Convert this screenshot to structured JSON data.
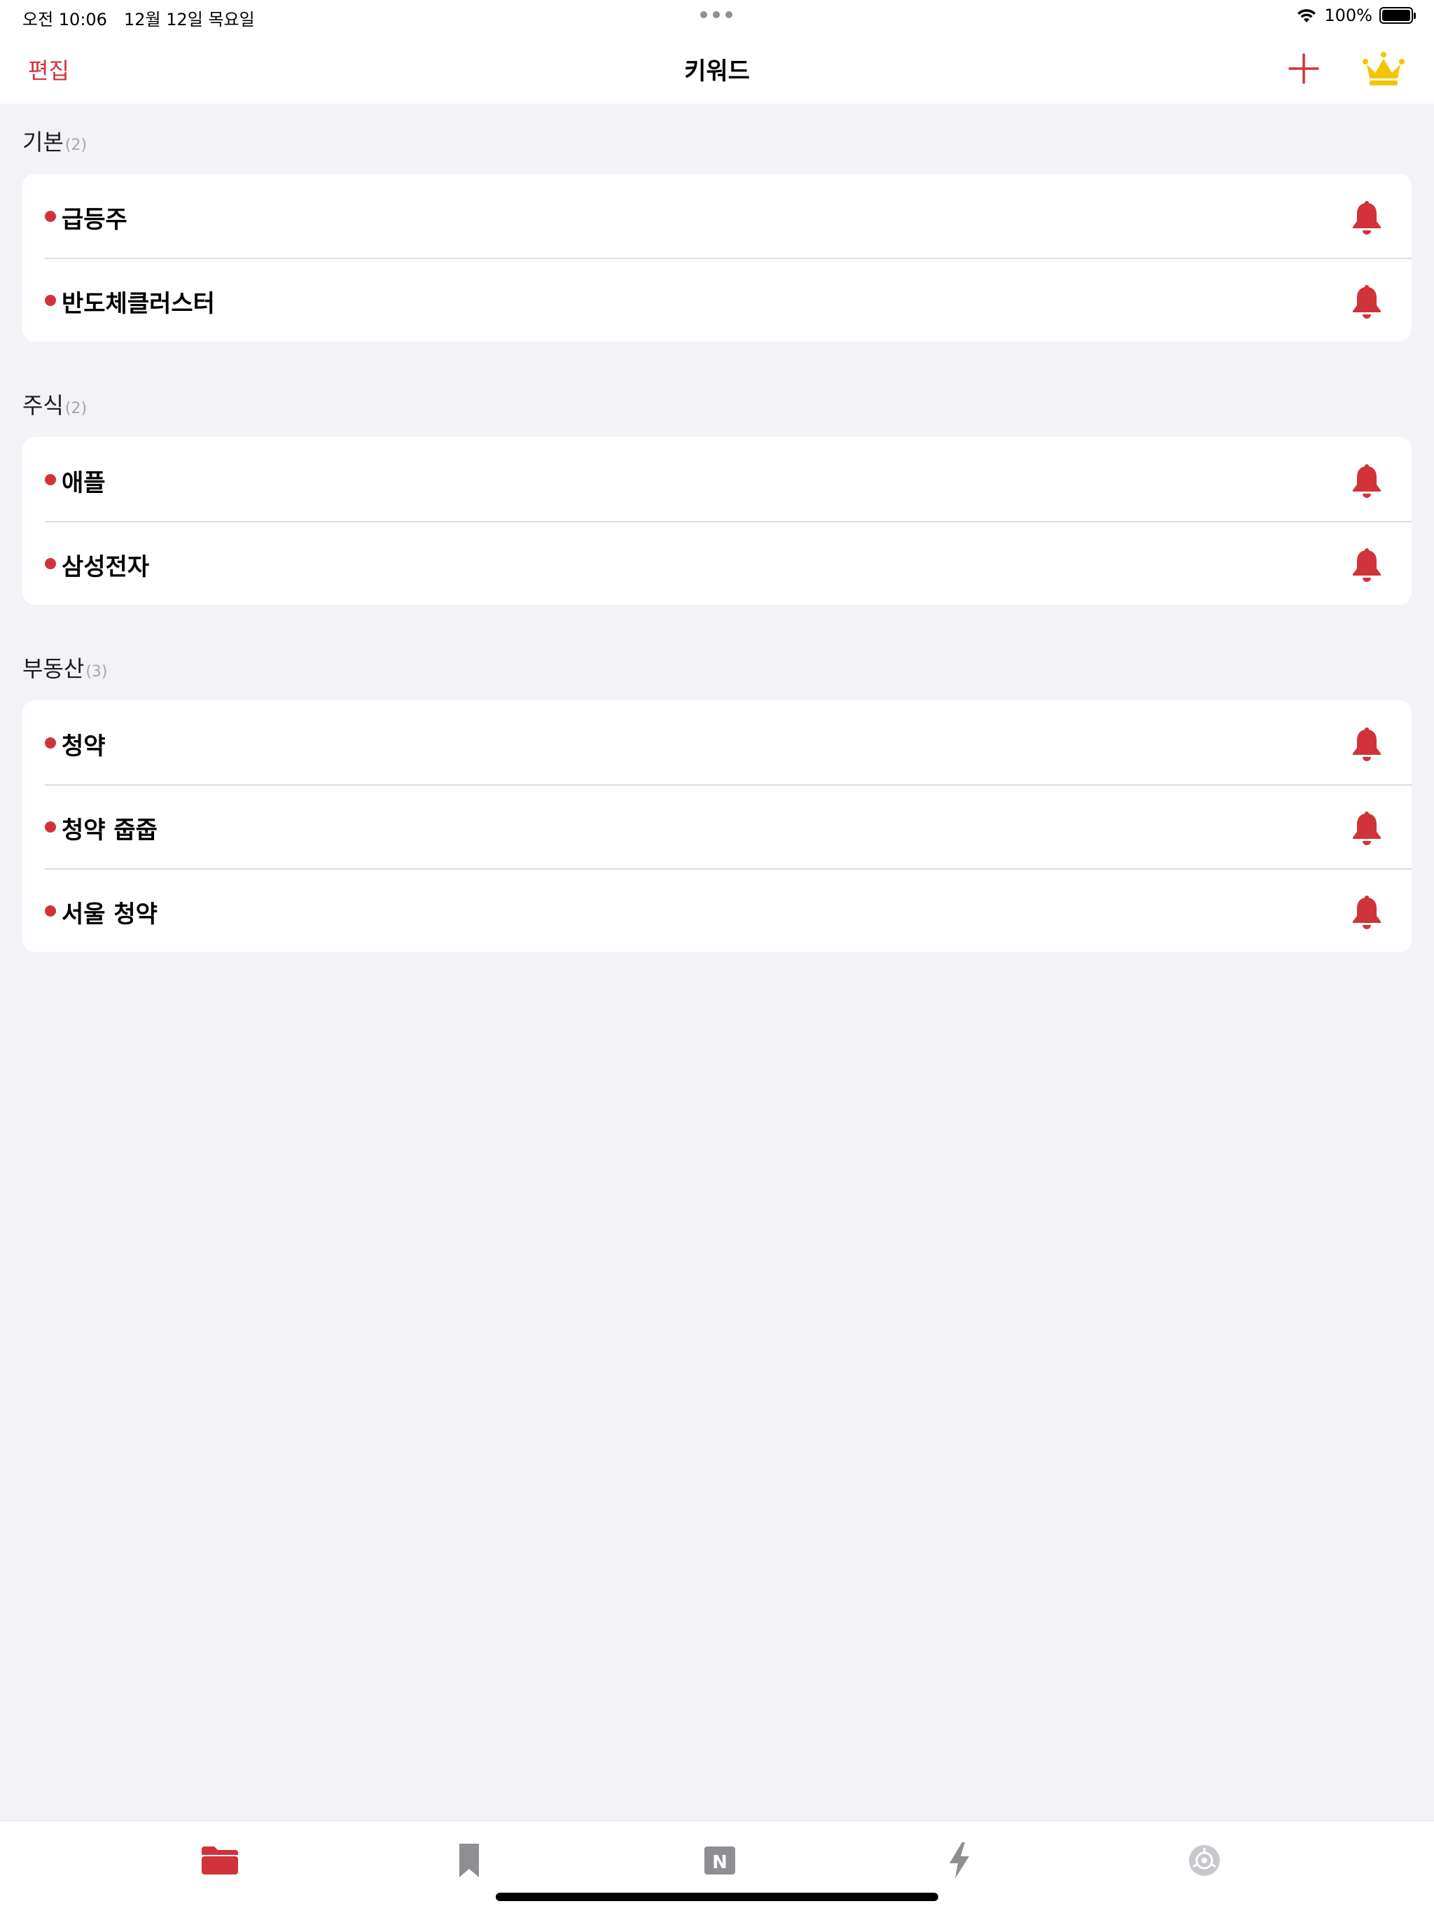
{
  "status_bar": {
    "time": "오전 10:06",
    "date": "12월 12일 목요일",
    "battery_text": "100%",
    "battery_level": 1.0
  },
  "nav": {
    "edit_label": "편집",
    "title": "키워드",
    "add_icon": "plus-icon",
    "premium_icon": "crown-icon"
  },
  "colors": {
    "accent": "#d0333a",
    "crown": "#f5c400",
    "background": "#f2f2f7",
    "tab_inactive": "#8e8e93"
  },
  "sections": [
    {
      "title": "기본",
      "count": "(2)",
      "items": [
        {
          "label": "급등주",
          "icon": "bell-icon"
        },
        {
          "label": "반도체클러스터",
          "icon": "bell-icon"
        }
      ]
    },
    {
      "title": "주식",
      "count": "(2)",
      "items": [
        {
          "label": "애플",
          "icon": "bell-icon"
        },
        {
          "label": "삼성전자",
          "icon": "bell-icon"
        }
      ]
    },
    {
      "title": "부동산",
      "count": "(3)",
      "items": [
        {
          "label": "청약",
          "icon": "bell-icon"
        },
        {
          "label": "청약 줍줍",
          "icon": "bell-icon"
        },
        {
          "label": "서울 청약",
          "icon": "bell-icon"
        }
      ]
    }
  ],
  "tabs": [
    {
      "icon": "folder-icon",
      "active": true
    },
    {
      "icon": "bookmark-icon",
      "active": false
    },
    {
      "icon": "news-n-icon",
      "active": false,
      "glyph": "N"
    },
    {
      "icon": "bolt-icon",
      "active": false
    },
    {
      "icon": "settings-gear-icon",
      "active": false
    }
  ]
}
